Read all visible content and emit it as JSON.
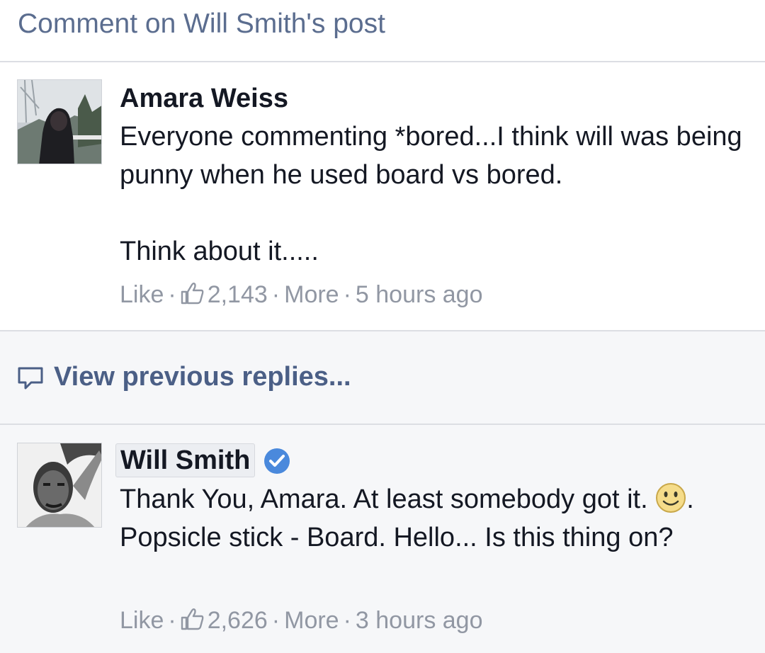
{
  "header": {
    "title": "Comment on Will Smith's post"
  },
  "comment": {
    "author": "Amara Weiss",
    "text_line1": "Everyone commenting *bored...I think will was being punny when he used board vs bored.",
    "text_line2": "Think about it.....",
    "like_label": "Like",
    "like_count": "2,143",
    "more_label": "More",
    "time": "5 hours ago"
  },
  "view_previous": {
    "label": "View previous replies..."
  },
  "reply": {
    "author": "Will Smith",
    "verified": true,
    "text_before_emoji": "Thank You, Amara. At least somebody got it. ",
    "text_after_emoji": ". Popsicle stick - Board. Hello... Is this thing on?",
    "like_label": "Like",
    "like_count": "2,626",
    "more_label": "More",
    "time": "3 hours ago"
  },
  "colors": {
    "link": "#4b5f86",
    "meta": "#9197a3",
    "text": "#141823",
    "verified": "#4a89dc"
  }
}
